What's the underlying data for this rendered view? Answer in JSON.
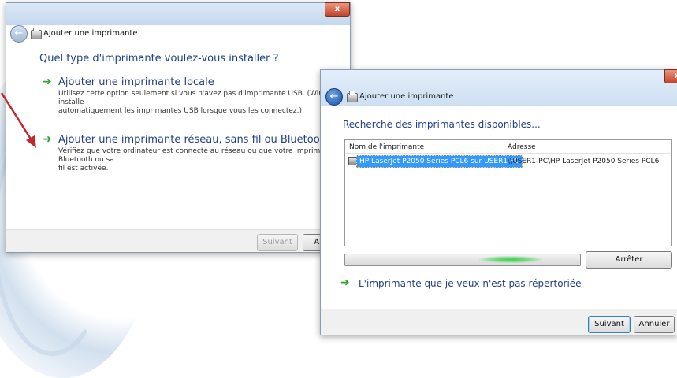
{
  "window1": {
    "title": "Ajouter une imprimante",
    "close_label": "x",
    "back_label": "←",
    "heading": "Quel type d'imprimante voulez-vous installer ?",
    "options": [
      {
        "title": "Ajouter une imprimante locale",
        "description_line1": "Utilisez cette option seulement si vous n'avez pas d'imprimante USB. (Windows installe",
        "description_line2": "automatiquement les imprimantes USB lorsque vous les connectez.)"
      },
      {
        "title": "Ajouter une imprimante réseau, sans fil ou Bluetooth",
        "description_line1": "Vérifiez que votre ordinateur est connecté au réseau ou que votre imprimante Bluetooth ou sa",
        "description_line2": "fil est activée."
      }
    ],
    "next_label": "Suivant",
    "cancel_label": "An"
  },
  "window2": {
    "title": "Ajouter une imprimante",
    "close_label": "x",
    "back_label": "←",
    "heading": "Recherche des imprimantes disponibles...",
    "columns": [
      "Nom de l'imprimante",
      "Adresse"
    ],
    "printers": [
      {
        "name": "HP LaserJet P2050 Series PCL6 sur USER1-PC",
        "address": "\\\\USER1-PC\\HP LaserJet P2050 Series PCL6"
      }
    ],
    "progress": "indeterminate",
    "stop_label": "Arrêter",
    "not_listed_label": "L'imprimante que je veux n'est pas répertoriée",
    "next_label": "Suivant",
    "cancel_label": "Annuler"
  },
  "colors": {
    "heading_blue": "#1f3f8a",
    "selection_blue": "#3399ff",
    "arrow_green": "#2ea12e",
    "annotation_red": "#c0282a"
  },
  "icons": [
    "printer-icon",
    "back-arrow-icon",
    "close-icon",
    "green-arrow-icon"
  ]
}
